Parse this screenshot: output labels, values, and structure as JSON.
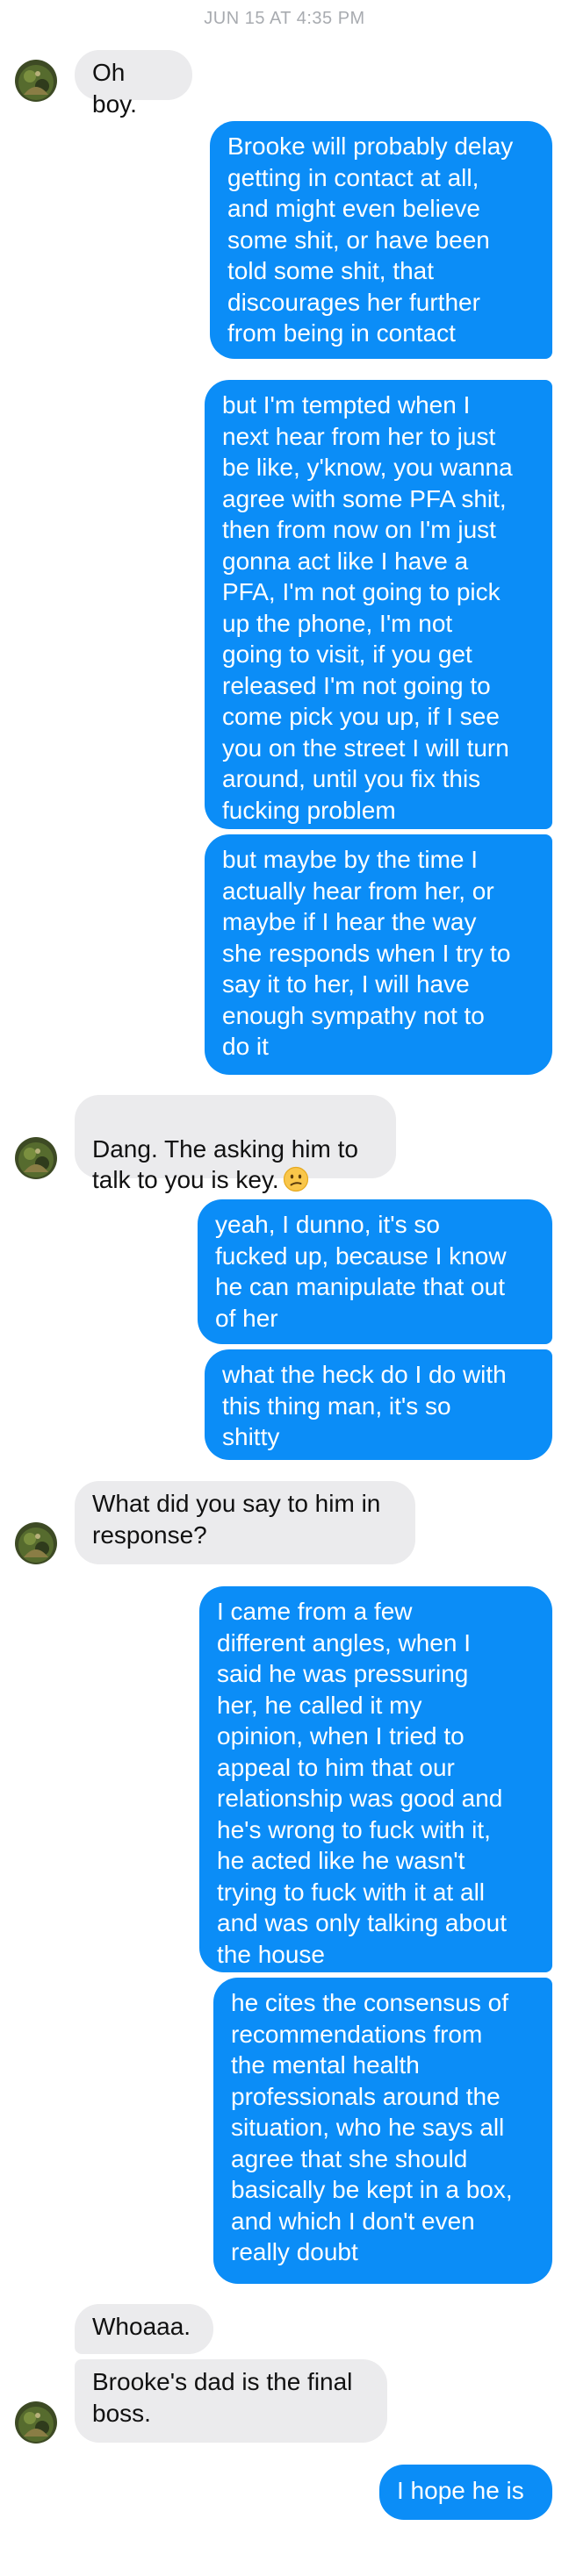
{
  "conversation": {
    "timestamp": "JUN 15 AT 4:35 PM",
    "messages": [
      {
        "from": "them",
        "text": "Oh boy."
      },
      {
        "from": "me",
        "text": "Brooke will probably delay\ngetting in contact at all,\nand might even believe\nsome shit, or have been\ntold some shit, that\ndiscourages her further\nfrom being in contact"
      },
      {
        "from": "me",
        "text": "but I'm tempted when I\nnext hear from her to just\nbe like, y'know, you wanna\nagree with some PFA shit,\nthen from now on I'm just\ngonna act like I have a\nPFA, I'm not going to pick\nup the phone, I'm not\ngoing to visit, if you get\nreleased I'm not going to\ncome pick you up, if I see\nyou on the street I will turn\naround, until you fix this\nfucking problem"
      },
      {
        "from": "me",
        "text": "but maybe by the time I\nactually hear from her, or\nmaybe if I hear the way\nshe responds when I try to\nsay it to her, I will have\nenough sympathy not to\ndo it"
      },
      {
        "from": "them",
        "text": "Dang. The asking him to\ntalk to you is key.",
        "emoji": "confused-face"
      },
      {
        "from": "me",
        "text": "yeah, I dunno, it's so\nfucked up, because I know\nhe can manipulate that out\nof her"
      },
      {
        "from": "me",
        "text": "what the heck do I do with\nthis thing man, it's so\nshitty"
      },
      {
        "from": "them",
        "text": "What did you say to him in\nresponse?"
      },
      {
        "from": "me",
        "text": "I came from a few\ndifferent angles, when I\nsaid he was pressuring\nher, he called it my\nopinion, when I tried to\nappeal to him that our\nrelationship was good and\nhe's wrong to fuck with it,\nhe acted like he wasn't\ntrying to fuck with it at all\nand was only talking about\nthe house"
      },
      {
        "from": "me",
        "text": "he cites the consensus of\nrecommendations from\nthe mental health\nprofessionals around the\nsituation, who he says all\nagree that she should\nbasically be kept in a box,\nand which I don't even\nreally doubt"
      },
      {
        "from": "them",
        "text": "Whoaaa."
      },
      {
        "from": "them",
        "text": "Brooke's dad is the final\nboss."
      },
      {
        "from": "me",
        "text": "I hope he is"
      }
    ]
  },
  "colors": {
    "outgoing": "#0b8df7",
    "incoming": "#ebebed",
    "timestamp": "#a8abb0"
  },
  "icons": {
    "avatar": "contact-avatar-icon",
    "emoji": "confused-face-emoji-icon"
  }
}
